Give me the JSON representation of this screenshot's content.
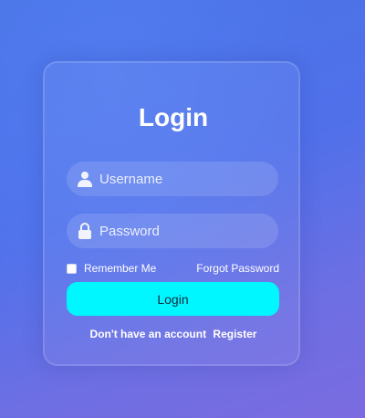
{
  "colors": {
    "background_start": "#4a74e6",
    "background_end": "#7b6be0",
    "button_accent": "#00f7ff",
    "text": "#ffffff"
  },
  "login_form": {
    "title": "Login",
    "username": {
      "placeholder": "Username",
      "value": "",
      "icon": "user-icon"
    },
    "password": {
      "placeholder": "Password",
      "value": "",
      "icon": "lock-icon"
    },
    "remember_label": "Remember Me",
    "remember_checked": false,
    "forgot_link": "Forgot Password",
    "login_button": "Login",
    "register_prompt": "Don't have an account",
    "register_link": "Register"
  }
}
